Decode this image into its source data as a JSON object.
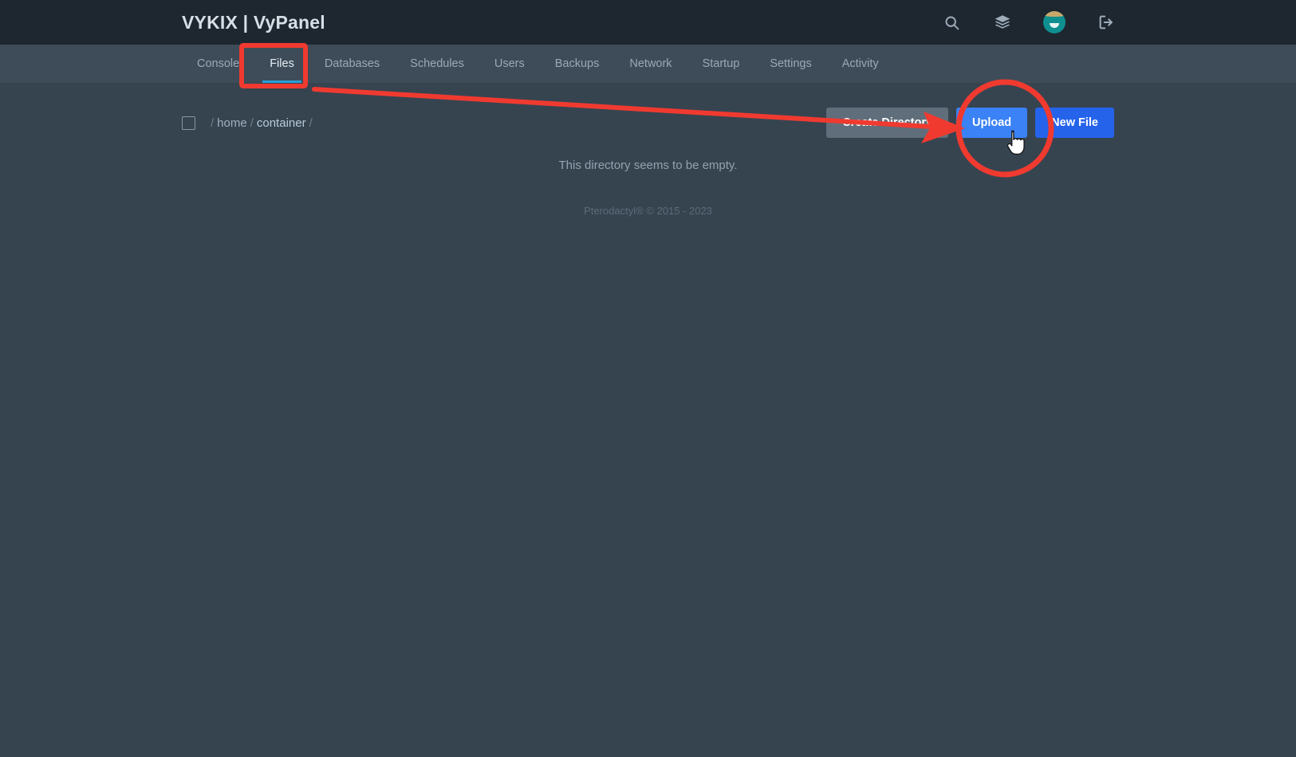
{
  "header": {
    "brand": "VYKIX | VyPanel",
    "actions": [
      {
        "name": "search-icon",
        "label": "Search"
      },
      {
        "name": "layers-icon",
        "label": "Servers"
      },
      {
        "name": "avatar",
        "label": "Account"
      },
      {
        "name": "logout-icon",
        "label": "Logout"
      }
    ]
  },
  "nav": {
    "items": [
      {
        "label": "Console",
        "active": false
      },
      {
        "label": "Files",
        "active": true
      },
      {
        "label": "Databases",
        "active": false
      },
      {
        "label": "Schedules",
        "active": false
      },
      {
        "label": "Users",
        "active": false
      },
      {
        "label": "Backups",
        "active": false
      },
      {
        "label": "Network",
        "active": false
      },
      {
        "label": "Startup",
        "active": false
      },
      {
        "label": "Settings",
        "active": false
      },
      {
        "label": "Activity",
        "active": false
      }
    ]
  },
  "filemanager": {
    "select_all_checked": false,
    "breadcrumb": {
      "lead_sep": "/",
      "items": [
        "home",
        "container"
      ],
      "trailing_sep": "/"
    },
    "buttons": {
      "create_directory": "Create Directory",
      "upload": "Upload",
      "new_file": "New File"
    },
    "empty_message": "This directory seems to be empty."
  },
  "footer": {
    "text": "Pterodactyl® © 2015 - 2023"
  },
  "annotations": {
    "color": "#f03a30",
    "highlight_rect_target": "Files",
    "highlight_circle_target": "Upload",
    "arrow_from": "Files tab",
    "arrow_to": "Upload button"
  },
  "colors": {
    "header_bg": "#1e2730",
    "nav_bg": "#3e4c59",
    "body_bg": "#364450",
    "accent_tab": "#2c9fd6",
    "upload_blue": "#3b82f6",
    "newfile_blue": "#2563eb",
    "grey_button": "#606e7b",
    "annotation_red": "#f03a30"
  }
}
